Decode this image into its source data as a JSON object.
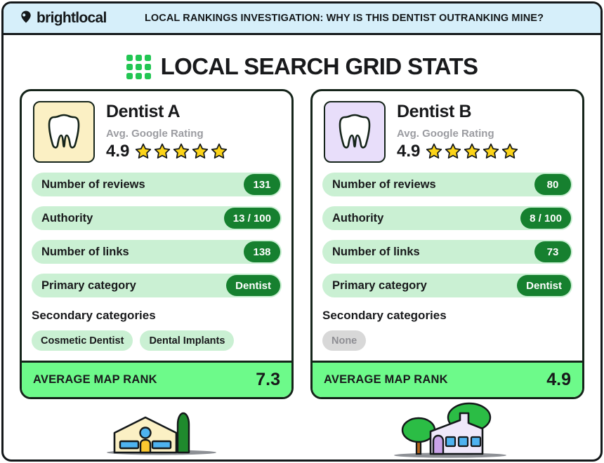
{
  "banner": {
    "logo_text": "brightlocal",
    "logo_icon": "map-pin-icon",
    "title": "LOCAL RANKINGS INVESTIGATION: WHY IS THIS DENTIST OUTRANKING MINE?"
  },
  "page": {
    "title": "LOCAL SEARCH GRID STATS",
    "grid_icon": "grid-dots-icon"
  },
  "colors": {
    "banner_bg": "#d6effa",
    "accent_green": "#22c653",
    "pill_green": "#16802f",
    "row_green": "#caf0d3",
    "footer_green": "#6dfa8a",
    "border_dark": "#15241a",
    "star_yellow": "#fcd419",
    "tooth_a_bg": "#fbf0c4",
    "tooth_b_bg": "#e8defa",
    "none_gray": "#d8d8d8"
  },
  "cards": [
    {
      "name": "Dentist A",
      "icon": "tooth-icon",
      "icon_bg": "#fbf0c4",
      "rating_label": "Avg. Google Rating",
      "rating_value": "4.9",
      "stars": 5,
      "stats": [
        {
          "label": "Number of reviews",
          "value": "131"
        },
        {
          "label": "Authority",
          "value": "13 / 100"
        },
        {
          "label": "Number of links",
          "value": "138"
        },
        {
          "label": "Primary category",
          "value": "Dentist"
        }
      ],
      "secondary_title": "Secondary categories",
      "secondary_categories": [
        "Cosmetic Dentist",
        "Dental Implants"
      ],
      "footer_label": "AVERAGE MAP RANK",
      "footer_value": "7.3",
      "illustration": "building-with-conifer-tree-illustration"
    },
    {
      "name": "Dentist B",
      "icon": "tooth-icon",
      "icon_bg": "#e8defa",
      "rating_label": "Avg. Google Rating",
      "rating_value": "4.9",
      "stars": 5,
      "stats": [
        {
          "label": "Number of reviews",
          "value": "80"
        },
        {
          "label": "Authority",
          "value": "8 / 100"
        },
        {
          "label": "Number of links",
          "value": "73"
        },
        {
          "label": "Primary category",
          "value": "Dentist"
        }
      ],
      "secondary_title": "Secondary categories",
      "secondary_categories": [
        "None"
      ],
      "footer_label": "AVERAGE MAP RANK",
      "footer_value": "4.9",
      "illustration": "building-with-round-trees-illustration"
    }
  ]
}
